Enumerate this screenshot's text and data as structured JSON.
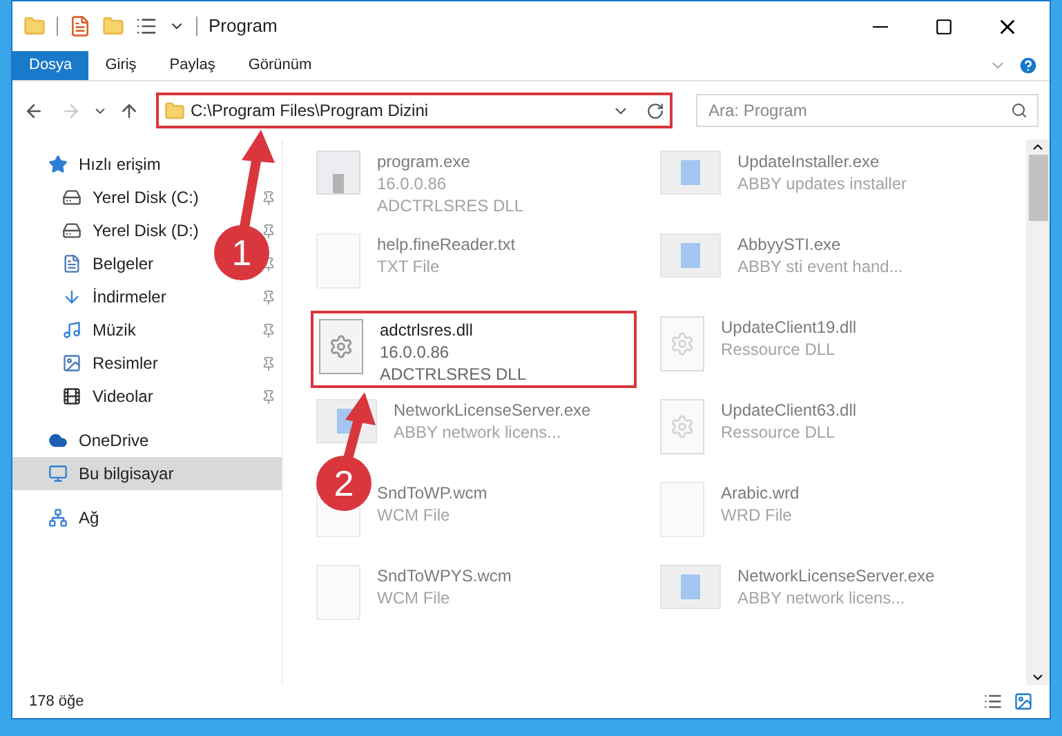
{
  "window": {
    "title": "Program"
  },
  "ribbon_tabs": [
    {
      "label": "Dosya",
      "selected": true
    },
    {
      "label": "Giriş",
      "selected": false
    },
    {
      "label": "Paylaş",
      "selected": false
    },
    {
      "label": "Görünüm",
      "selected": false
    }
  ],
  "address": {
    "path": "C:\\Program Files\\Program Dizini",
    "highlighted": true
  },
  "search": {
    "placeholder": "Ara: Program"
  },
  "sidebar": {
    "items": [
      {
        "label": "Hızlı erişim",
        "kind": "star",
        "pinned": false,
        "selected": false,
        "sub": false
      },
      {
        "label": "Yerel Disk (C:)",
        "kind": "disk",
        "pinned": true,
        "selected": false,
        "sub": true
      },
      {
        "label": "Yerel Disk (D:)",
        "kind": "disk",
        "pinned": true,
        "selected": false,
        "sub": true
      },
      {
        "label": "Belgeler",
        "kind": "docs",
        "pinned": true,
        "selected": false,
        "sub": true
      },
      {
        "label": "İndirmeler",
        "kind": "download",
        "pinned": true,
        "selected": false,
        "sub": true
      },
      {
        "label": "Müzik",
        "kind": "music",
        "pinned": true,
        "selected": false,
        "sub": true
      },
      {
        "label": "Resimler",
        "kind": "pictures",
        "pinned": true,
        "selected": false,
        "sub": true
      },
      {
        "label": "Videolar",
        "kind": "video",
        "pinned": true,
        "selected": false,
        "sub": true
      },
      {
        "label": "OneDrive",
        "kind": "cloud",
        "pinned": false,
        "selected": false,
        "sub": false
      },
      {
        "label": "Bu bilgisayar",
        "kind": "pc",
        "pinned": false,
        "selected": true,
        "sub": false
      },
      {
        "label": "Ağ",
        "kind": "network",
        "pinned": false,
        "selected": false,
        "sub": false
      }
    ]
  },
  "files": [
    {
      "kind": "exe",
      "name": "program.exe",
      "lines": [
        "16.0.0.86",
        "ADCTRLSRES DLL"
      ],
      "highlighted": false
    },
    {
      "kind": "app",
      "name": "UpdateInstaller.exe",
      "lines": [
        "ABBY updates installer"
      ],
      "highlighted": false
    },
    {
      "kind": "blank",
      "name": "help.fineReader.txt",
      "lines": [
        "TXT File"
      ],
      "highlighted": false
    },
    {
      "kind": "app",
      "name": "AbbyySTI.exe",
      "lines": [
        "ABBY sti event hand..."
      ],
      "highlighted": false
    },
    {
      "kind": "dll",
      "name": "adctrlsres.dll",
      "lines": [
        "16.0.0.86",
        "ADCTRLSRES DLL"
      ],
      "highlighted": true
    },
    {
      "kind": "dll",
      "name": "UpdateClient19.dll",
      "lines": [
        "Ressource DLL"
      ],
      "highlighted": false
    },
    {
      "kind": "app",
      "name": "NetworkLicenseServer.exe",
      "lines": [
        "ABBY network licens..."
      ],
      "highlighted": false
    },
    {
      "kind": "dll",
      "name": "UpdateClient63.dll",
      "lines": [
        "Ressource DLL"
      ],
      "highlighted": false
    },
    {
      "kind": "blank",
      "name": "SndToWP.wcm",
      "lines": [
        "WCM File"
      ],
      "highlighted": false
    },
    {
      "kind": "blank",
      "name": "Arabic.wrd",
      "lines": [
        "WRD File"
      ],
      "highlighted": false
    },
    {
      "kind": "blank",
      "name": "SndToWPYS.wcm",
      "lines": [
        "WCM File"
      ],
      "highlighted": false
    },
    {
      "kind": "app",
      "name": "NetworkLicenseServer.exe",
      "lines": [
        "ABBY network licens..."
      ],
      "highlighted": false
    }
  ],
  "status_bar": {
    "count": "178 öğe"
  },
  "annotations": [
    {
      "number": "1"
    },
    {
      "number": "2"
    }
  ]
}
